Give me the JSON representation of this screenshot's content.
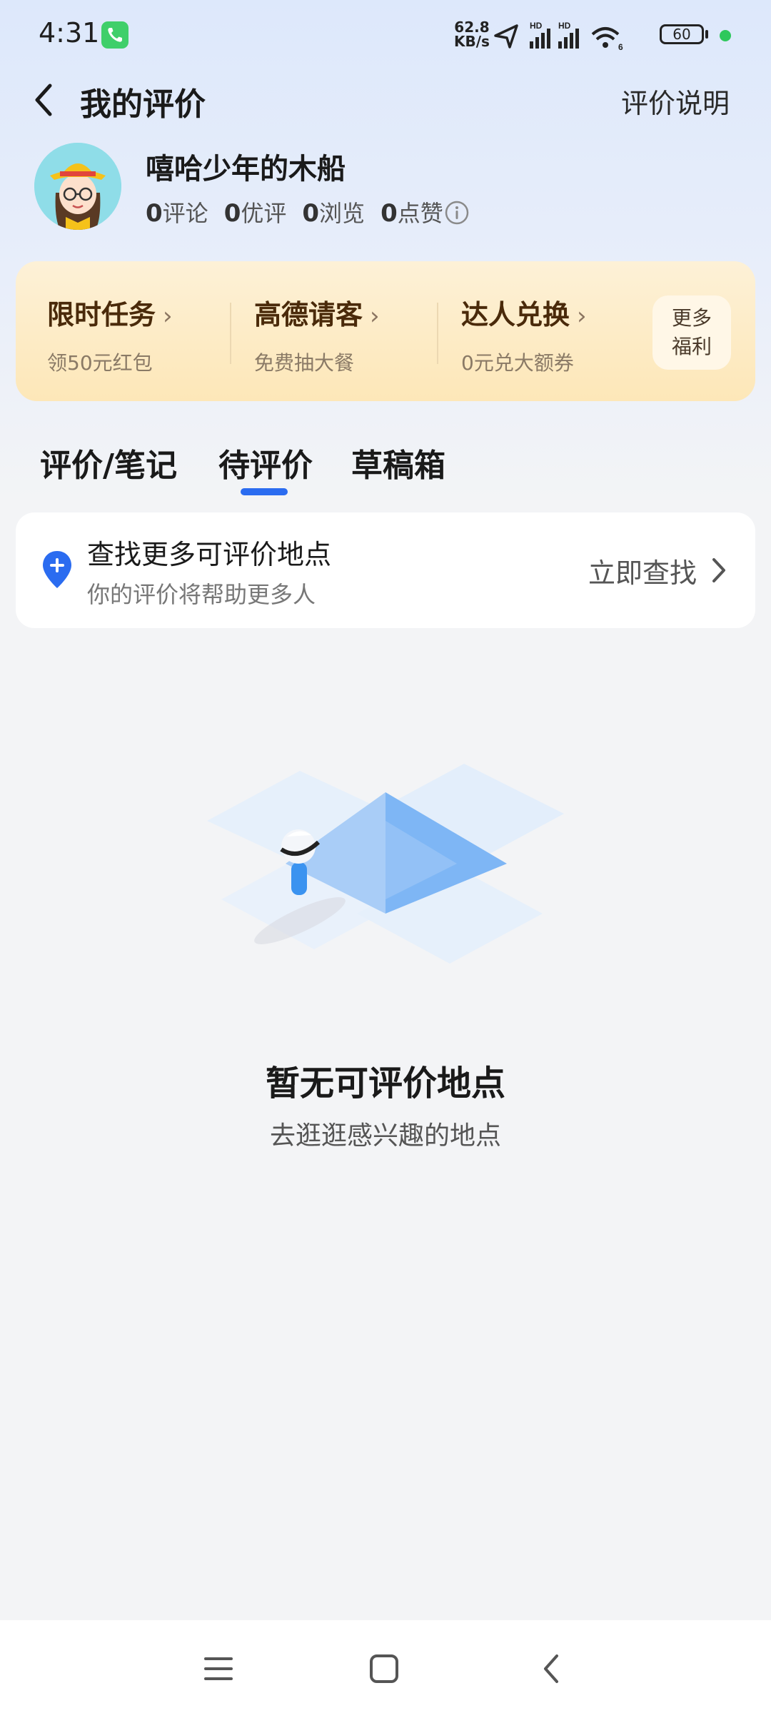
{
  "status_bar": {
    "time": "4:31",
    "net_speed": "62.8",
    "net_unit": "KB/s",
    "battery": "60"
  },
  "header": {
    "title": "我的评价",
    "right_link": "评价说明"
  },
  "profile": {
    "name": "嘻哈少年的木船",
    "stats": [
      {
        "num": "0",
        "label": "评论"
      },
      {
        "num": "0",
        "label": "优评"
      },
      {
        "num": "0",
        "label": "浏览"
      },
      {
        "num": "0",
        "label": "点赞"
      }
    ]
  },
  "welfare": {
    "items": [
      {
        "title": "限时任务",
        "sub": "领50元红包"
      },
      {
        "title": "高德请客",
        "sub": "免费抽大餐"
      },
      {
        "title": "达人兑换",
        "sub": "0元兑大额券"
      }
    ],
    "more_line1": "更多",
    "more_line2": "福利"
  },
  "tabs": [
    {
      "label": "评价/笔记"
    },
    {
      "label": "待评价"
    },
    {
      "label": "草稿箱"
    }
  ],
  "find_card": {
    "title": "查找更多可评价地点",
    "subtitle": "你的评价将帮助更多人",
    "action": "立即查找"
  },
  "empty_state": {
    "title": "暂无可评价地点",
    "subtitle": "去逛逛感兴趣的地点"
  },
  "colors": {
    "accent": "#2b6cf0",
    "welfare_bg": "#fde7b8",
    "welfare_text": "#4a2a0a"
  }
}
